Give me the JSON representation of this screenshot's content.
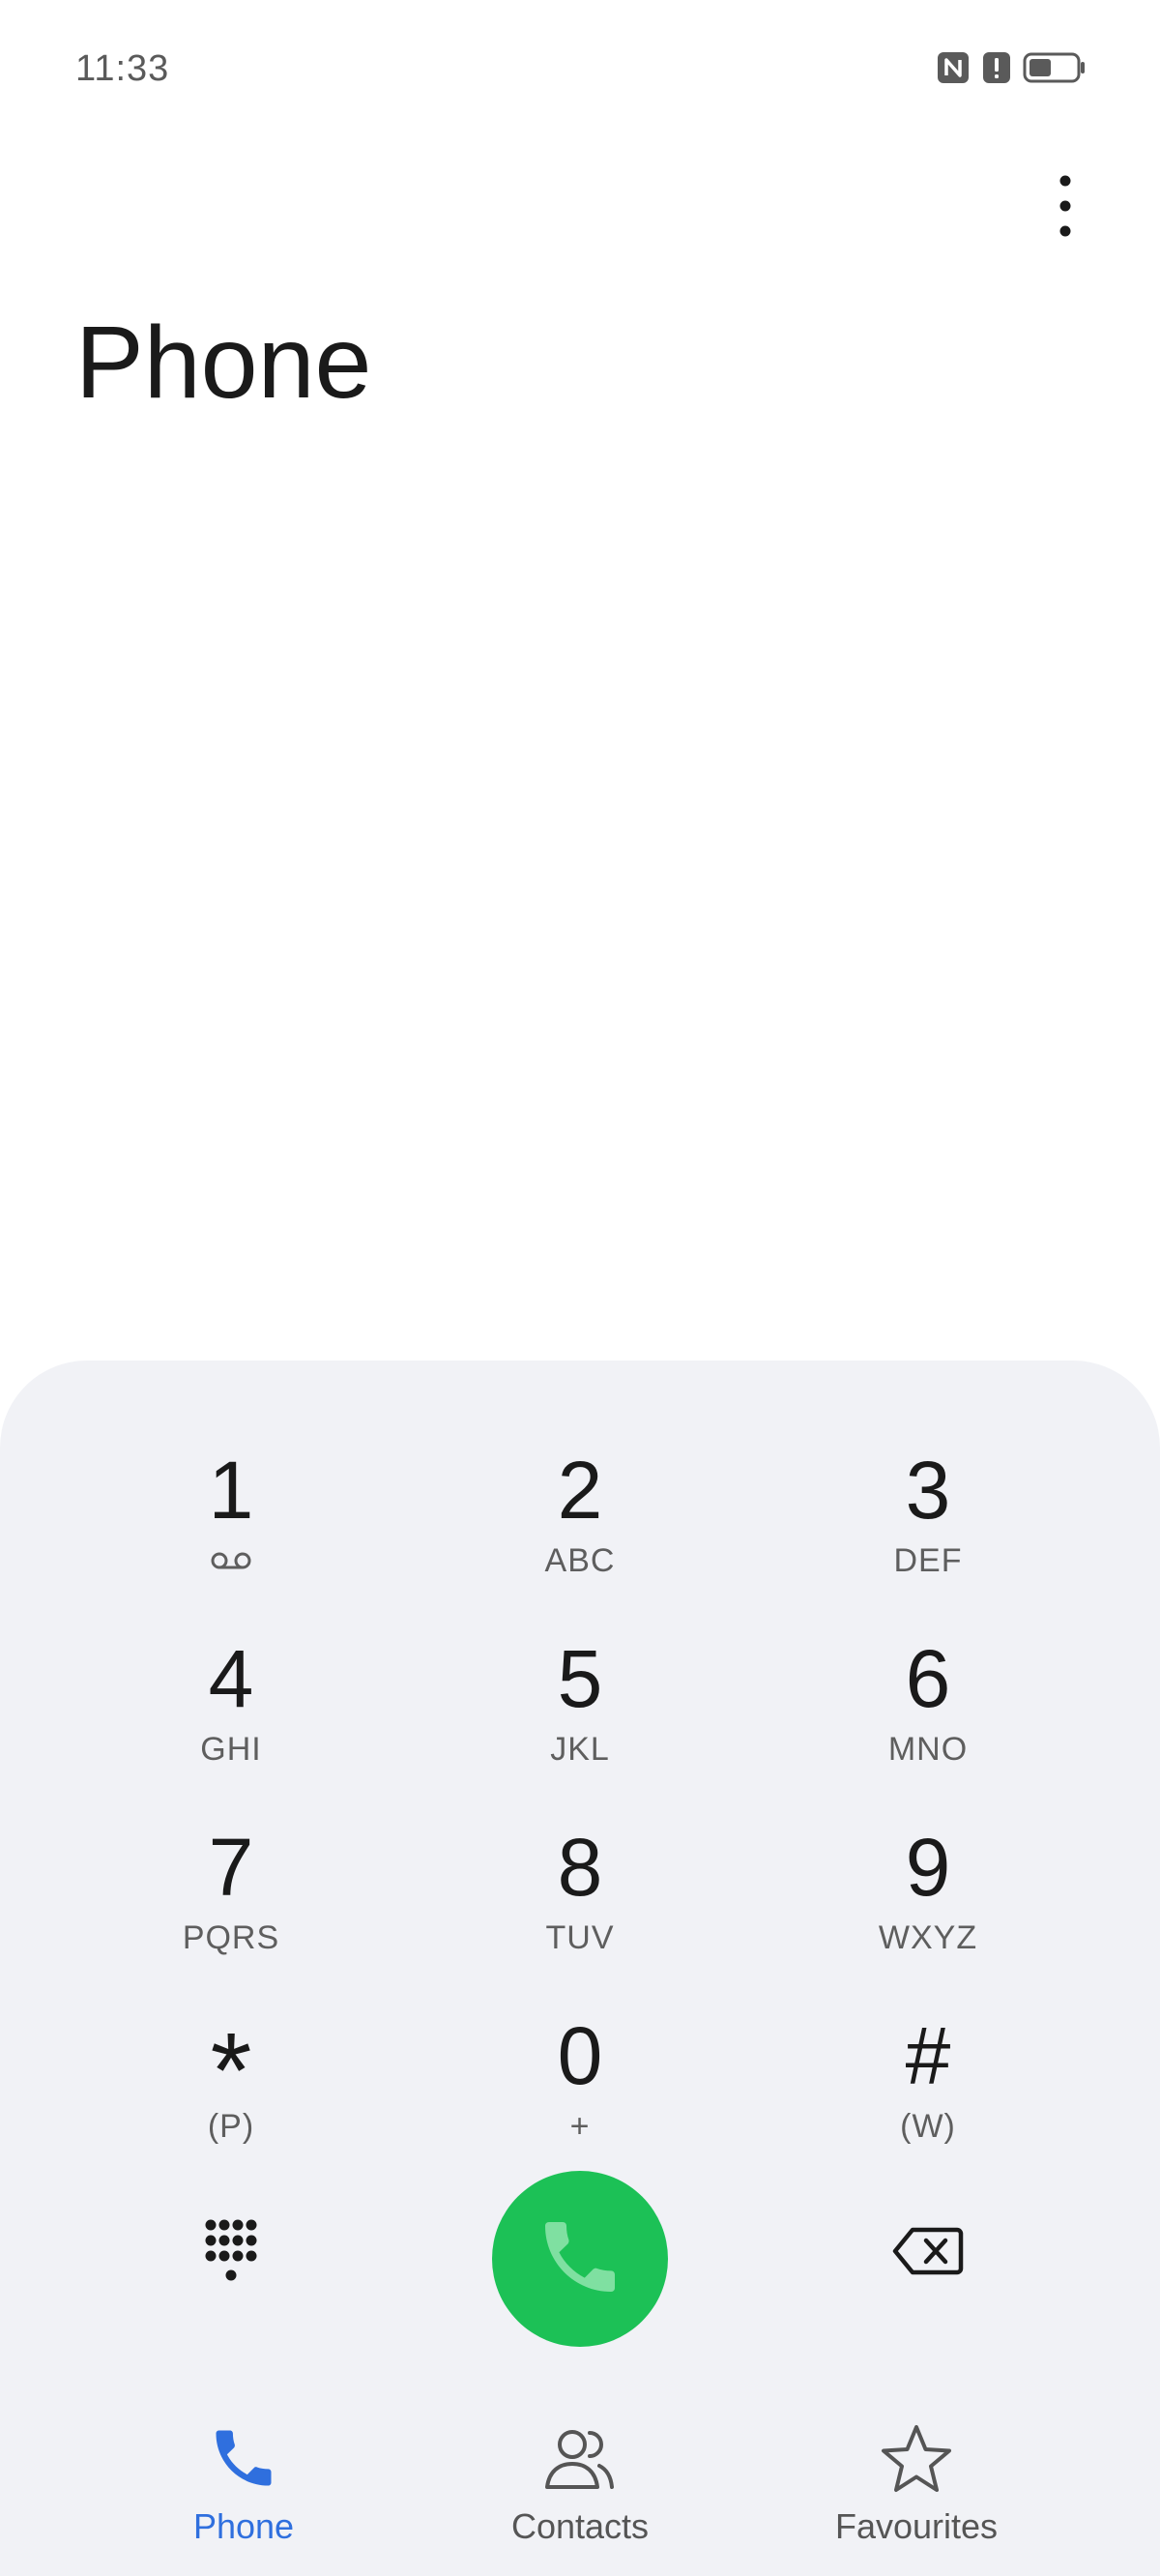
{
  "status_bar": {
    "time": "11:33",
    "icons": [
      "nfc-icon",
      "alert-icon",
      "battery-icon"
    ]
  },
  "header": {
    "title": "Phone",
    "more_icon": "more-vert-icon"
  },
  "dialpad": {
    "keys": [
      {
        "digit": "1",
        "letters": "",
        "sub_icon": "voicemail-icon"
      },
      {
        "digit": "2",
        "letters": "ABC"
      },
      {
        "digit": "3",
        "letters": "DEF"
      },
      {
        "digit": "4",
        "letters": "GHI"
      },
      {
        "digit": "5",
        "letters": "JKL"
      },
      {
        "digit": "6",
        "letters": "MNO"
      },
      {
        "digit": "7",
        "letters": "PQRS"
      },
      {
        "digit": "8",
        "letters": "TUV"
      },
      {
        "digit": "9",
        "letters": "WXYZ"
      },
      {
        "digit": "*",
        "letters": "(P)"
      },
      {
        "digit": "0",
        "letters": "+"
      },
      {
        "digit": "#",
        "letters": "(W)"
      }
    ],
    "actions": {
      "left_icon": "dialpad-toggle-icon",
      "call_icon": "phone-call-icon",
      "right_icon": "backspace-icon"
    }
  },
  "bottom_nav": {
    "items": [
      {
        "label": "Phone",
        "icon": "phone-icon",
        "active": true
      },
      {
        "label": "Contacts",
        "icon": "contacts-icon",
        "active": false
      },
      {
        "label": "Favourites",
        "icon": "star-icon",
        "active": false
      }
    ]
  },
  "colors": {
    "accent": "#2f6fde",
    "call_green": "#1cc156",
    "dialpad_bg": "#f1f2f6"
  }
}
